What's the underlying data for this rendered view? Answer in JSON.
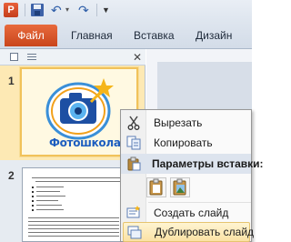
{
  "quick_access": {
    "app_icon_letter": "P",
    "icons": [
      "powerpoint-app-icon",
      "save-icon",
      "undo-icon",
      "redo-icon",
      "customize-toolbar-icon"
    ]
  },
  "ribbon": {
    "tabs": [
      {
        "label": "Файл",
        "active": true
      },
      {
        "label": "Главная"
      },
      {
        "label": "Вставка"
      },
      {
        "label": "Дизайн"
      }
    ]
  },
  "slides_panel": {
    "slides": [
      {
        "number": "1",
        "logo_text": "Фотошкола",
        "selected": true
      },
      {
        "number": "2",
        "selected": false
      }
    ]
  },
  "context_menu": {
    "items": [
      {
        "label": "Вырезать",
        "icon": "scissors-icon"
      },
      {
        "label": "Копировать",
        "icon": "copy-icon"
      },
      {
        "label": "Параметры вставки:",
        "icon": "paste-icon",
        "header": true
      },
      {
        "label": "Создать слайд",
        "icon": "new-slide-icon"
      },
      {
        "label": "Дублировать слайд",
        "icon": "duplicate-slide-icon",
        "highlighted": true
      }
    ],
    "paste_options": [
      "paste-keep-formatting-icon",
      "paste-picture-icon"
    ]
  },
  "colors": {
    "file_tab": "#d5522a",
    "selection": "#fde9b4",
    "menu_hover": "#fbe2a4"
  }
}
